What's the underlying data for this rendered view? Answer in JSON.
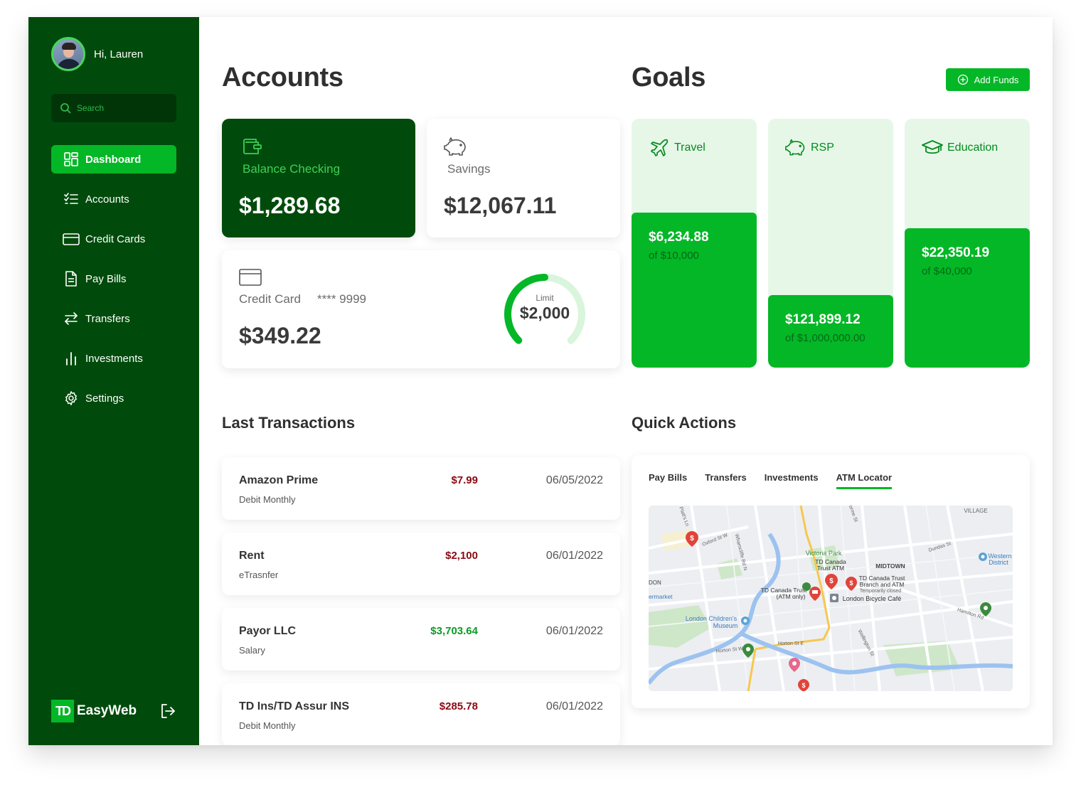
{
  "user": {
    "greeting": "Hi, Lauren"
  },
  "search": {
    "placeholder": "Search"
  },
  "nav": {
    "dashboard": "Dashboard",
    "accounts": "Accounts",
    "credit_cards": "Credit Cards",
    "pay_bills": "Pay Bills",
    "transfers": "Transfers",
    "investments": "Investments",
    "settings": "Settings"
  },
  "brand": {
    "logo_text": "TD",
    "name": "EasyWeb"
  },
  "accounts": {
    "title": "Accounts",
    "checking": {
      "label": "Balance Checking",
      "amount": "$1,289.68"
    },
    "savings": {
      "label": "Savings",
      "amount": "$12,067.11"
    },
    "credit": {
      "label": "Credit Card",
      "masked_number": "**** 9999",
      "amount": "$349.22",
      "limit_label": "Limit",
      "limit_value": "$2,000",
      "utilization": 0.5
    }
  },
  "goals": {
    "title": "Goals",
    "add_funds_label": "Add Funds",
    "items": [
      {
        "name": "Travel",
        "amount": "$6,234.88",
        "target": "of $10,000",
        "progress": 0.6235
      },
      {
        "name": "RSP",
        "amount": "$121,899.12",
        "target": "of $1,000,000.00",
        "progress": 0.29
      },
      {
        "name": "Education",
        "amount": "$22,350.19",
        "target": "of $40,000",
        "progress": 0.5588
      }
    ]
  },
  "transactions": {
    "title": "Last Transactions",
    "items": [
      {
        "name": "Amazon Prime",
        "sub": "Debit Monthly",
        "amount": "$7.99",
        "date": "06/05/2022",
        "type": "neg"
      },
      {
        "name": "Rent",
        "sub": "eTrasnfer",
        "amount": "$2,100",
        "date": "06/01/2022",
        "type": "neg"
      },
      {
        "name": "Payor LLC",
        "sub": "Salary",
        "amount": "$3,703.64",
        "date": "06/01/2022",
        "type": "pos"
      },
      {
        "name": "TD Ins/TD Assur INS",
        "sub": "Debit Monthly",
        "amount": "$285.78",
        "date": "06/01/2022",
        "type": "neg"
      }
    ]
  },
  "quick_actions": {
    "title": "Quick Actions",
    "tabs": [
      "Pay Bills",
      "Transfers",
      "Investments",
      "ATM Locator"
    ],
    "active_tab": "ATM Locator",
    "map_labels": {
      "victoria_park": "Victoria Park",
      "atm1_line1": "TD Canada",
      "atm1_line2": "Trust ATM",
      "midtown": "MIDTOWN",
      "branch_line1": "TD Canada Trust",
      "branch_line2": "Branch and ATM",
      "branch_line3": "Temporarily closed",
      "atm2_line1": "TD Canada Trust",
      "atm2_line2": "(ATM only)",
      "bicycle": "London Bicycle Café",
      "museum_line1": "London Children's",
      "museum_line2": "Museum",
      "western_line1": "Western",
      "western_line2": "District",
      "village": "VILLAGE",
      "oxford": "Oxford St W",
      "dundas": "Dundas St",
      "horton": "Horton St E",
      "hamilton": "Hamilton Rd",
      "wellington": "Wellington St",
      "wharncliffe": "Wharncliffe Rd N",
      "ermarket": "ermarket",
      "don": "DON",
      "horton_w": "Horton St W",
      "platts": "Platt's Ln",
      "orme": "orme St"
    }
  },
  "colors": {
    "sidebar": "#004b0c",
    "accent": "#04b726",
    "goal_bg": "#e6f7e8",
    "negative": "#8b0a12",
    "positive": "#0b9a26"
  }
}
